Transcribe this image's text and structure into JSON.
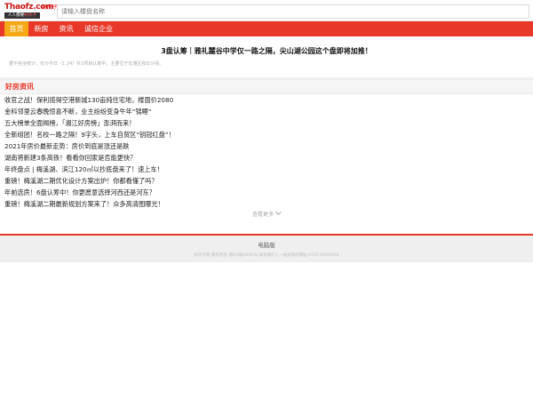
{
  "header": {
    "logo_text": "Thaofz.com",
    "logo_slogan": "好房子",
    "logo_sub_left": "人人都要",
    "logo_sub_right": "好房子",
    "search_placeholder": "请输入楼盘名称"
  },
  "nav": {
    "items": [
      {
        "label": "首页",
        "active": true
      },
      {
        "label": "新房",
        "active": false
      },
      {
        "label": "资讯",
        "active": false
      },
      {
        "label": "诚信企业",
        "active": false
      }
    ]
  },
  "headline": {
    "title": "3盘认筹｜雅礼麓谷中学仅一路之隔，尖山湖公园这个盘即将加推！",
    "note": "据不完全统计，长沙今日（1.24）共3项目认筹中，主要位于长雅区和长沙县。"
  },
  "news": {
    "section_title": "好房资讯",
    "items": [
      "收官之战！保利揽得空港新城130亩纯住宅地，楼面价2080",
      "金科邻里云春晚惊喜不断，业主纷纷变身牛年“锦鲤”",
      "五大榜单全面揭榜，「湘江好房榜」澎湃而来！",
      "全新组团！名校一路之隔！9字头，上车自贸区“钥冠红盘”！",
      "2021年房价最新走势：房价到底是涨还是跌",
      "湖南将新建3条高铁！看看你回家是否能更快？",
      "年终盘点 | 梅溪湖、滨江120㎡以抄底盘来了！速上车！",
      "重磅！梅溪湖二期优化设计方案出炉！你都看懂了吗？",
      "年前选房！6盘认筹中！你更愿意选择河西还是河东？",
      "重磅！梅溪湖二期最新规划方案来了！众多高清图曝光！"
    ],
    "more_label": "查看更多"
  },
  "footer": {
    "desktop_link": "电脑版",
    "copyright": "好房子网 版权所有 湘ICP备XXXX号 联系我们 | 一站式购房网站 0731-XXXXXXX"
  }
}
